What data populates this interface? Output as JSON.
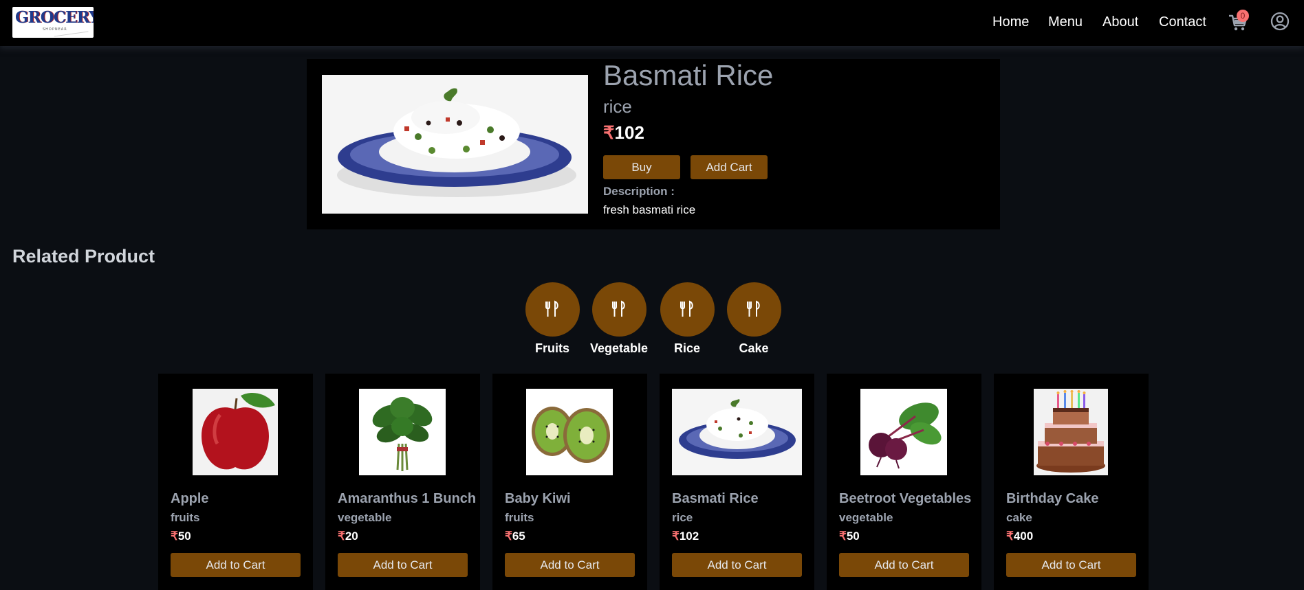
{
  "header": {
    "logo_text": "GROCERY",
    "logo_sub": "SHOPNEAR",
    "nav": [
      "Home",
      "Menu",
      "About",
      "Contact"
    ],
    "cart_count": "0",
    "icons": [
      "cart-icon",
      "user-circle-icon"
    ]
  },
  "product": {
    "title": "Basmati Rice",
    "category": "rice",
    "currency": "₹",
    "price": "102",
    "buy_label": "Buy",
    "add_cart_label": "Add Cart",
    "description_label": "Description :",
    "description": "fresh basmati rice"
  },
  "related": {
    "title": "Related Product",
    "categories": [
      {
        "label": "Fruits",
        "icon": "utensils-icon"
      },
      {
        "label": "Vegetable",
        "icon": "utensils-icon"
      },
      {
        "label": "Rice",
        "icon": "utensils-icon"
      },
      {
        "label": "Cake",
        "icon": "utensils-icon"
      }
    ],
    "items": [
      {
        "name": "Apple",
        "category": "fruits",
        "currency": "₹",
        "price": "50",
        "button": "Add to Cart"
      },
      {
        "name": "Amaranthus 1 Bunch",
        "category": "vegetable",
        "currency": "₹",
        "price": "20",
        "button": "Add to Cart"
      },
      {
        "name": "Baby Kiwi",
        "category": "fruits",
        "currency": "₹",
        "price": "65",
        "button": "Add to Cart"
      },
      {
        "name": "Basmati Rice",
        "category": "rice",
        "currency": "₹",
        "price": "102",
        "button": "Add to Cart"
      },
      {
        "name": "Beetroot Vegetables",
        "category": "vegetable",
        "currency": "₹",
        "price": "50",
        "button": "Add to Cart"
      },
      {
        "name": "Birthday Cake",
        "category": "cake",
        "currency": "₹",
        "price": "400",
        "button": "Add to Cart"
      }
    ]
  },
  "colors": {
    "accent_button": "#7a4807",
    "rupee": "#f87171",
    "background": "#0b0e13",
    "panel": "#000000"
  }
}
